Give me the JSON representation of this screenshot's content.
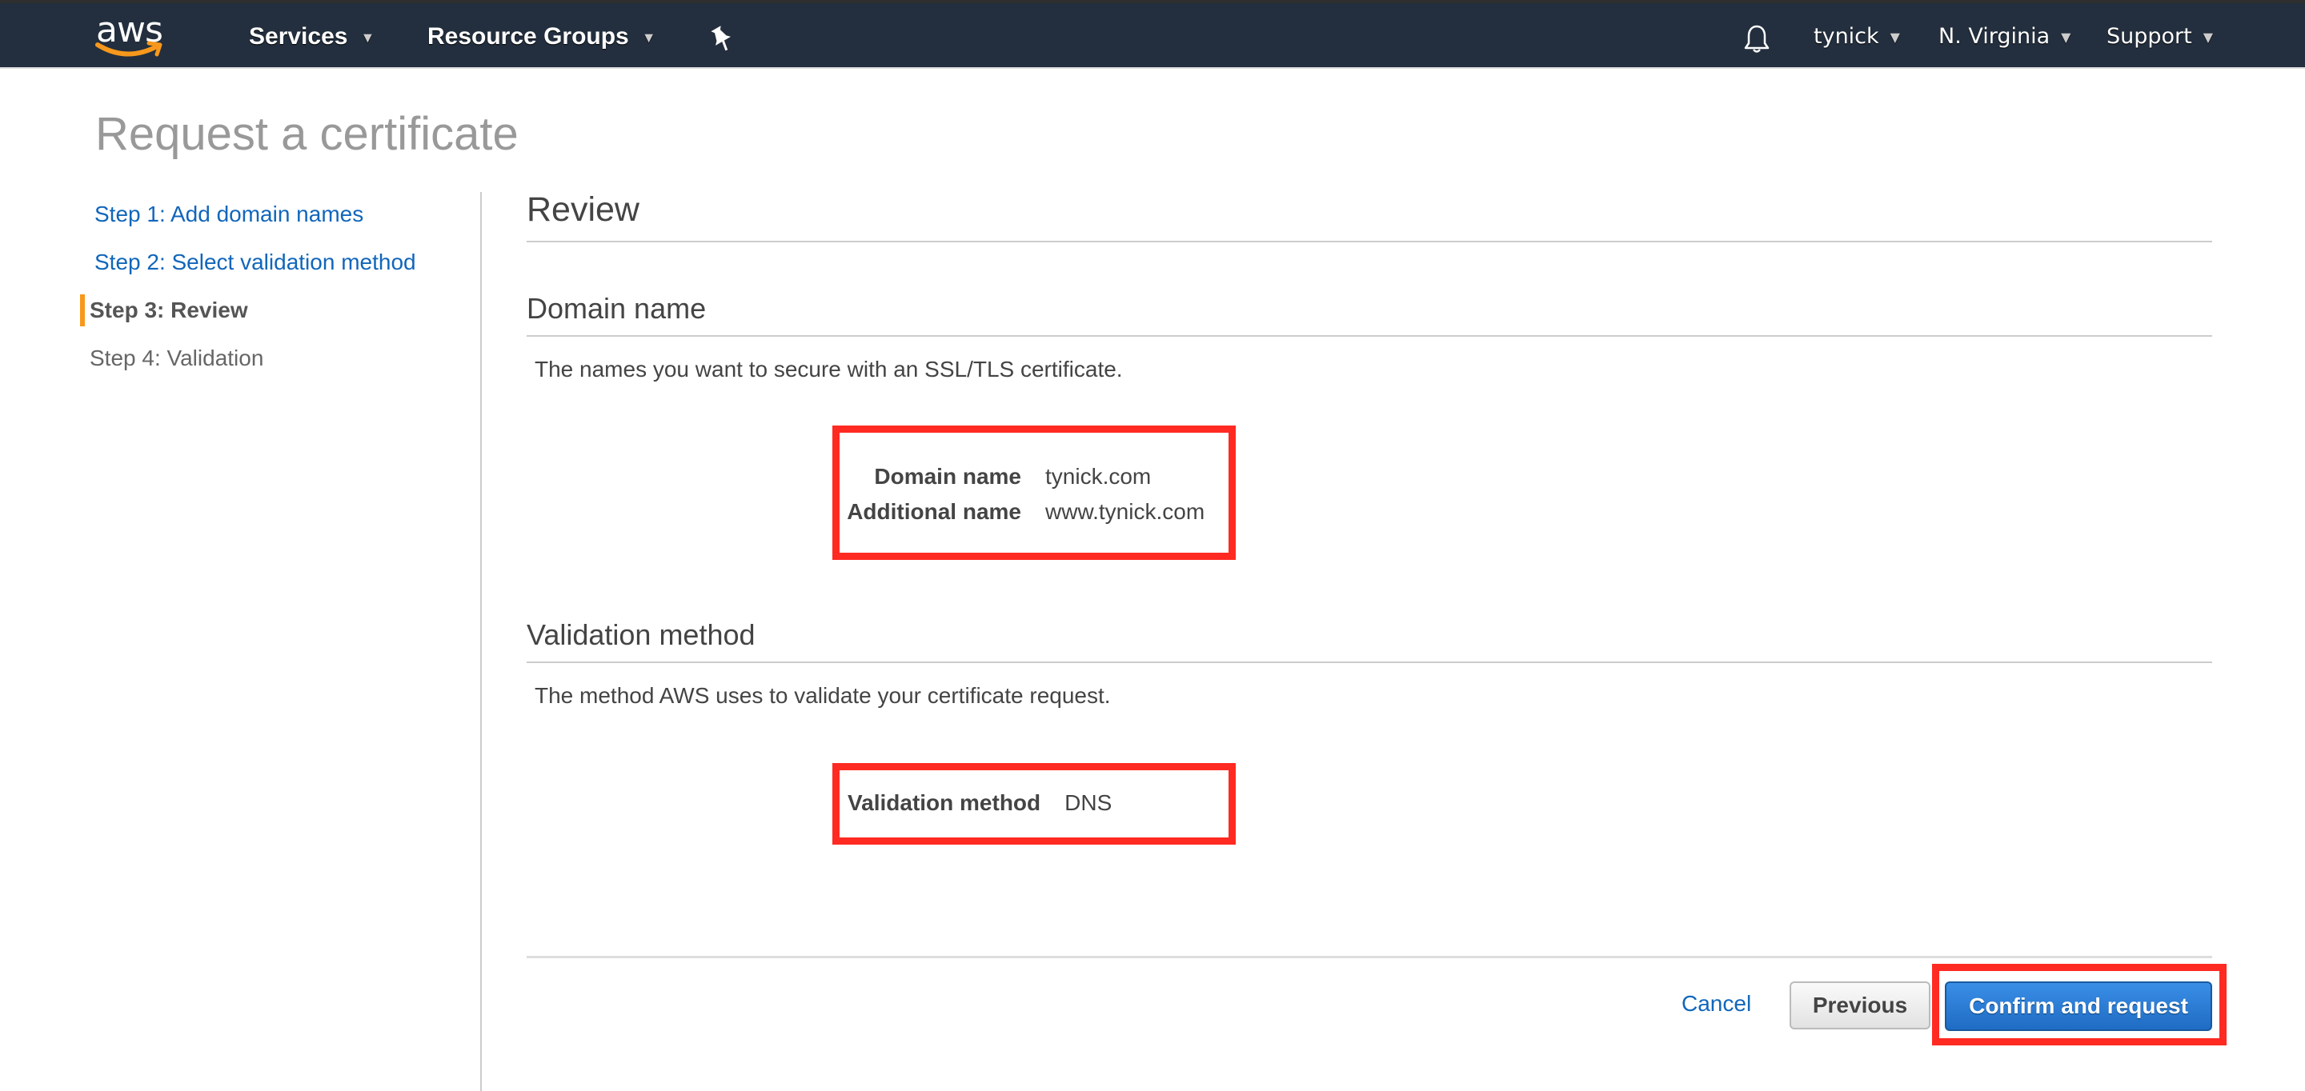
{
  "topbar": {
    "logo_text": "aws",
    "services": "Services",
    "resource_groups": "Resource Groups",
    "user": "tynick",
    "region": "N. Virginia",
    "support": "Support",
    "icons": {
      "pin": "pin-icon",
      "bell": "bell-icon",
      "caret": "caret-down-icon"
    }
  },
  "page": {
    "title": "Request a certificate"
  },
  "steps": [
    {
      "label": "Step 1: Add domain names",
      "state": "link"
    },
    {
      "label": "Step 2: Select validation method",
      "state": "link"
    },
    {
      "label": "Step 3: Review",
      "state": "active"
    },
    {
      "label": "Step 4: Validation",
      "state": "pending"
    }
  ],
  "review": {
    "heading": "Review",
    "domain_section": {
      "heading": "Domain name",
      "description": "The names you want to secure with an SSL/TLS certificate.",
      "rows": [
        {
          "label": "Domain name",
          "value": "tynick.com"
        },
        {
          "label": "Additional name",
          "value": "www.tynick.com"
        }
      ]
    },
    "validation_section": {
      "heading": "Validation method",
      "description": "The method AWS uses to validate your certificate request.",
      "rows": [
        {
          "label": "Validation method",
          "value": "DNS"
        }
      ]
    }
  },
  "footer": {
    "cancel": "Cancel",
    "previous": "Previous",
    "confirm": "Confirm and request"
  },
  "colors": {
    "topbar_bg": "#232f3e",
    "link": "#1166bb",
    "active_step_bar": "#f7981d",
    "primary_button": "#2a7bd6",
    "highlight_annotation": "#ff2a22"
  }
}
